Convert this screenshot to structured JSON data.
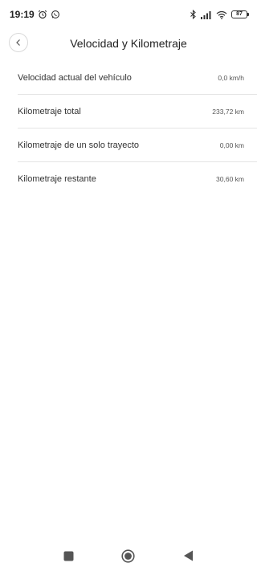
{
  "status_bar": {
    "time": "19:19",
    "battery": "87",
    "icons": [
      "alarm-icon",
      "whatsapp-icon",
      "bluetooth-icon",
      "signal-icon",
      "wifi-icon",
      "battery-icon"
    ]
  },
  "header": {
    "title": "Velocidad y Kilometraje",
    "back_icon": "chevron-left-icon"
  },
  "items": [
    {
      "label": "Velocidad actual del vehículo",
      "value": "0,0 km/h"
    },
    {
      "label": "Kilometraje total",
      "value": "233,72 km"
    },
    {
      "label": "Kilometraje de un solo trayecto",
      "value": "0,00 km"
    },
    {
      "label": "Kilometraje restante",
      "value": "30,60 km"
    }
  ],
  "nav_bar": {
    "icons": [
      "recents-square-icon",
      "home-circle-icon",
      "back-triangle-icon"
    ]
  }
}
